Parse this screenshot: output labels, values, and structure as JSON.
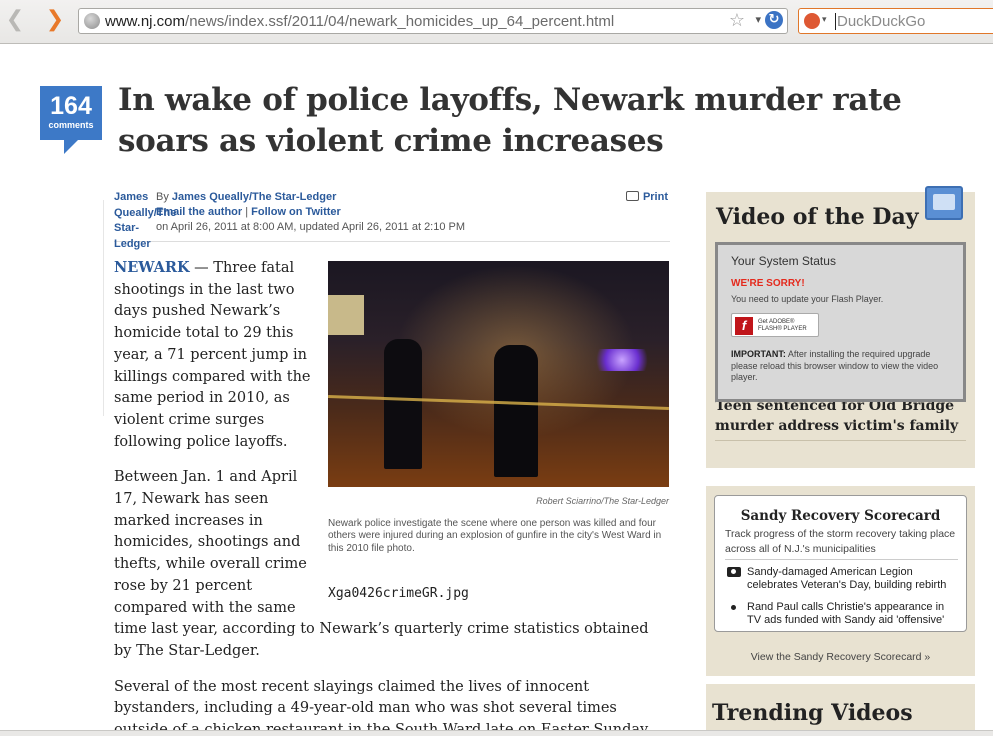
{
  "browser": {
    "url_host": "www.nj.com",
    "url_path": "/news/index.ssf/2011/04/newark_homicides_up_64_percent.html",
    "search_placeholder": "DuckDuckGo",
    "back_icon": "back-arrow-icon",
    "forward_icon": "forward-arrow-icon"
  },
  "article": {
    "comment_count": "164",
    "comment_label": "comments",
    "headline": "In wake of police layoffs, Newark murder rate soars as violent crime increases",
    "byline": {
      "author_short": "James Queally/The Star-Ledger",
      "by_prefix": "By",
      "author": "James Queally/The Star-Ledger",
      "email": "Email the author",
      "separator": "|",
      "follow": "Follow on Twitter",
      "date": "on April 26, 2011 at 8:00 AM, updated April 26, 2011 at 2:10 PM",
      "print": "Print"
    },
    "dateline": "NEWARK",
    "p1": " — Three fatal shootings in the last two days pushed Newark’s homicide total to 29 this year, a 71 percent jump in killings compared with the same period in 2010, as violent crime surges following police layoffs.",
    "p2": "Between Jan. 1 and April 17, Newark has seen marked increases in homicides, shootings and thefts, while overall crime rose by 21 percent compared with the same time last year, according to Newark’s quarterly crime statistics obtained by The Star-Ledger.",
    "p3": "Several of the most recent slayings claimed the lives of innocent bystanders, including a 49-year-old man who was shot several times outside of a chicken restaurant in the South Ward late on Easter Sunday.",
    "photo": {
      "credit": "Robert Sciarrino/The Star-Ledger",
      "caption": "Newark police investigate the scene where one person was killed and four others were injured during an explosion of gunfire in the city's West Ward in this 2010 file photo.",
      "filename": "Xga0426crimeGR.jpg"
    }
  },
  "sidebar": {
    "video": {
      "title": "Video of the Day",
      "status": "Your System Status",
      "sorry": "WE'RE SORRY!",
      "update": "You need to update your Flash Player.",
      "btn_line1": "Get ADOBE®",
      "btn_line2": "FLASH® PLAYER",
      "note_bold": "IMPORTANT:",
      "note": " After installing the required upgrade please reload this browser window to view the video player.",
      "headline": "Teen sentenced for Old Bridge murder address victim's family"
    },
    "sandy": {
      "title": "Sandy Recovery Scorecard",
      "desc": "Track progress of the storm recovery taking place across all of N.J.'s municipalities",
      "item1": "Sandy-damaged American Legion celebrates Veteran's Day, building rebirth",
      "item2": "Rand Paul calls Christie's appearance in TV ads funded with Sandy aid 'offensive'",
      "more": "View the Sandy Recovery Scorecard »"
    },
    "trending": {
      "title": "Trending Videos"
    }
  },
  "colors": {
    "link": "#2b5a9b",
    "badge": "#3d79c7",
    "rail": "#e8e2d1",
    "alert": "#e42a1d"
  }
}
